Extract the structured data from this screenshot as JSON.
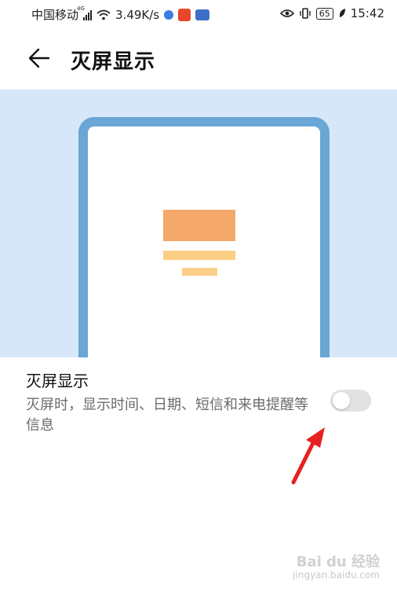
{
  "status_bar": {
    "carrier": "中国移动",
    "network_type": "4G",
    "speed": "3.49K/s",
    "battery": "65",
    "time": "15:42"
  },
  "header": {
    "back_icon": "arrow-left-icon",
    "title": "灭屏显示"
  },
  "illustration": {
    "bg_color": "#d5e7f8",
    "phone_border_color": "#6aa6d6",
    "accent_block_color": "#f4a96a",
    "accent_line_color": "#fccf86"
  },
  "setting": {
    "title": "灭屏显示",
    "description": "灭屏时，显示时间、日期、短信和来电提醒等信息",
    "toggle_state": "off"
  },
  "annotation": {
    "arrow_color": "#e62020"
  },
  "watermark": {
    "brand": "Bai du 经验",
    "url": "jingyan.baidu.com"
  }
}
